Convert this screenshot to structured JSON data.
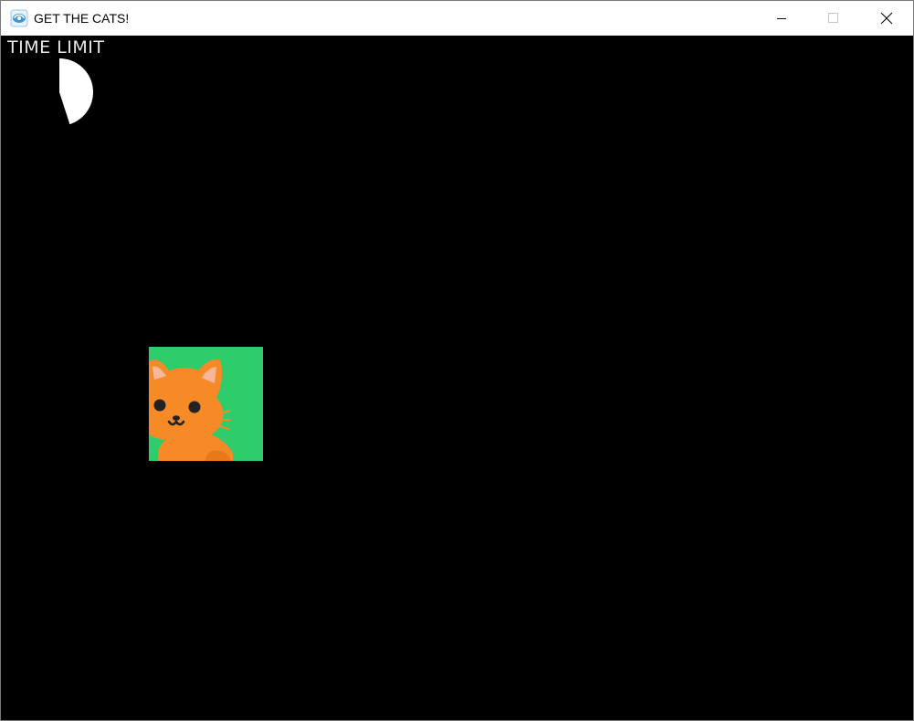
{
  "window": {
    "title": "GET THE CATS!",
    "icon": "app-swirl-icon",
    "buttons": {
      "minimize": "minimize-icon",
      "maximize": "maximize-icon",
      "close": "close-icon"
    }
  },
  "game": {
    "time_label": "TIME LIMIT",
    "time_remaining_fraction": 0.45,
    "target": {
      "kind": "cat",
      "icon": "cat-face-icon"
    }
  },
  "colors": {
    "background": "#000000",
    "timer_fill": "#ffffff",
    "tile_background": "#2ecc6a",
    "cat_orange": "#f68a26",
    "cat_ear_inner": "#f7b79a",
    "cat_features": "#222222"
  }
}
